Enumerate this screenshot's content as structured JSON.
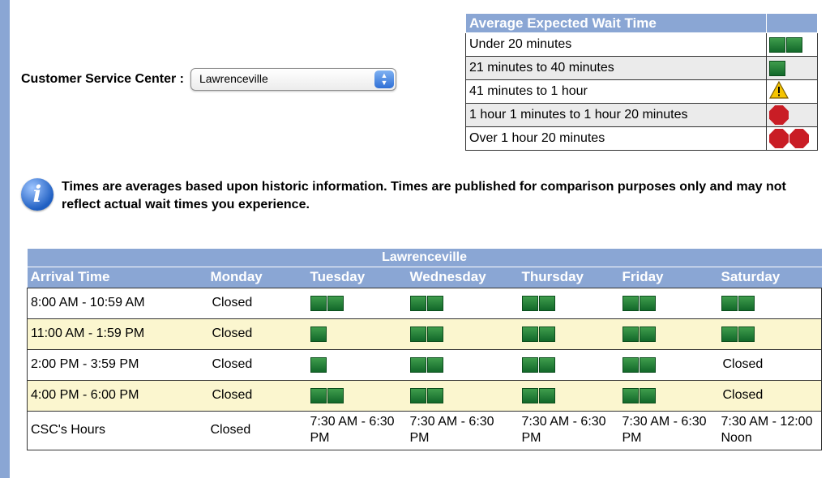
{
  "selector": {
    "label": "Customer Service Center :",
    "value": "Lawrenceville"
  },
  "legend": {
    "title": "Average Expected Wait Time",
    "items": [
      {
        "label": "Under 20 minutes",
        "symbol": "two-green-squares"
      },
      {
        "label": "21 minutes to 40 minutes",
        "symbol": "one-green-square"
      },
      {
        "label": "41 minutes to 1 hour",
        "symbol": "warning-icon"
      },
      {
        "label": "1 hour 1 minutes to 1 hour 20 minutes",
        "symbol": "stop-icon"
      },
      {
        "label": "Over 1 hour 20 minutes",
        "symbol": "two-stop-icons"
      }
    ]
  },
  "note": {
    "icon": "info-icon",
    "text": "Times are averages based upon historic information. Times are published for comparison purposes only and may not reflect actual wait times you experience."
  },
  "schedule": {
    "title": "Lawrenceville",
    "columns": [
      "Arrival Time",
      "Monday",
      "Tuesday",
      "Wednesday",
      "Thursday",
      "Friday",
      "Saturday"
    ],
    "rows": [
      {
        "time": "8:00 AM - 10:59 AM",
        "monday": "Closed",
        "tuesday": "two-green-squares",
        "wednesday": "two-green-squares",
        "thursday": "two-green-squares",
        "friday": "two-green-squares",
        "saturday": "two-green-squares"
      },
      {
        "time": "11:00 AM - 1:59 PM",
        "monday": "Closed",
        "tuesday": "one-green-square",
        "wednesday": "two-green-squares",
        "thursday": "two-green-squares",
        "friday": "two-green-squares",
        "saturday": "two-green-squares"
      },
      {
        "time": "2:00 PM - 3:59 PM",
        "monday": "Closed",
        "tuesday": "one-green-square",
        "wednesday": "two-green-squares",
        "thursday": "two-green-squares",
        "friday": "two-green-squares",
        "saturday": "Closed"
      },
      {
        "time": "4:00 PM - 6:00 PM",
        "monday": "Closed",
        "tuesday": "two-green-squares",
        "wednesday": "two-green-squares",
        "thursday": "two-green-squares",
        "friday": "two-green-squares",
        "saturday": "Closed"
      }
    ],
    "hours": {
      "label": "CSC's Hours",
      "monday": "Closed",
      "tuesday": "7:30 AM - 6:30 PM",
      "wednesday": "7:30 AM - 6:30 PM",
      "thursday": "7:30 AM - 6:30 PM",
      "friday": "7:30 AM - 6:30 PM",
      "saturday": "7:30 AM - 12:00 Noon"
    }
  },
  "colors": {
    "header_blue": "#8aa6d4",
    "row_alt": "#fbf6cf",
    "green": "#1d7a34",
    "red": "#c91d25",
    "warning": "#f5c400"
  }
}
